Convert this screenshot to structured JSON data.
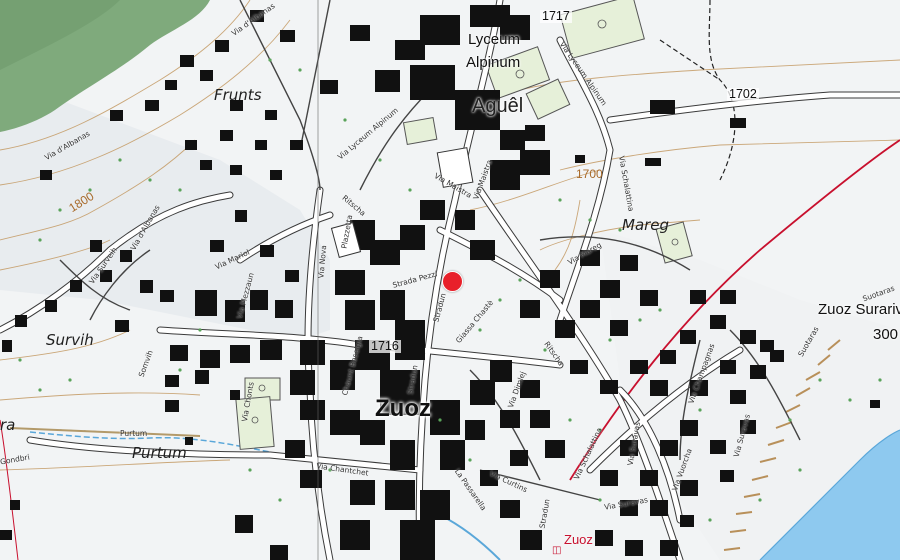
{
  "map": {
    "style": "swiss topographic",
    "colors": {
      "background": "#f2f4f5",
      "forest": "#7faa7c",
      "building": "#111111",
      "road": "#ffffff",
      "road_casing": "#3a3a3a",
      "contour": "#c49a64",
      "river": "#8ec9ef",
      "rail": "#c8102e",
      "sports_field": "#e6f0d9",
      "marker": "#e8202a"
    },
    "marker": {
      "type": "location-pin",
      "color": "#e8202a"
    },
    "labels": {
      "village": "Zuoz",
      "agel": "Aguêl",
      "lyceum": "Lyceum",
      "alpinum": "Alpinum",
      "frunts": "Frunts",
      "mareg": "Mareg",
      "survih": "Survih",
      "purtum": "Purtum",
      "zuoz_surariv": "Zuoz Surariv",
      "surariv_suffix": "300",
      "ra": "ra",
      "station": "Zuoz"
    },
    "elevations": {
      "e1717": "1717",
      "e1702": "1702",
      "e1716": "1716"
    },
    "contours": {
      "c1800": "1800",
      "c1700": "1700"
    },
    "streets": {
      "via_albanas": "Via d'Albanas",
      "via_albanas2": "Via d'Albanas",
      "via_albanas3": "Via d'Albanas",
      "via_surveih": "Via Surveih",
      "via_mariol": "Via Mariol",
      "via_mezzaun": "Via Mezzaun",
      "via_nova": "Via Nova",
      "plazzetta": "Plazzetta",
      "ritscha": "Ritscha",
      "ritscha2": "Ritscha",
      "via_lyceum": "Via Lyceum Alpinum",
      "via_lyceum2": "Via Lyceum Alpinum",
      "via_maistra": "Via Maistra",
      "via_maistra2": "Via Maistra",
      "strada_pezzi": "Strada Pezzi",
      "stradun": "Stradun",
      "stradun2": "Stradun",
      "stradun3": "Stradun",
      "chaunt_baselgia": "Chaunt Baselgia",
      "giassa_chasteo": "Giassa Chastè",
      "via_dimuet": "Via Dimlej",
      "via_schalatina": "Via Schalattina",
      "via_schalatina2": "Via Schalattina",
      "via_mareg": "Via Mareg",
      "via_chantchet": "Via Chantchet",
      "la_passarella": "La Passarella",
      "via_curtins": "Via Curtins",
      "via_suravas": "Via Suravas",
      "via_suravas2": "Via Suravas",
      "via_suravas3": "Via Suravas",
      "via_champagnas": "Via Champagnas",
      "via_vuorcha": "Via Vuorcha",
      "suotaras": "Suotaras",
      "suotaras2": "Suotaras",
      "purtum_way": "Purtum",
      "chonts": "Via Chonts",
      "samuel": "Somvih",
      "gondbri": "Gondbri"
    }
  }
}
